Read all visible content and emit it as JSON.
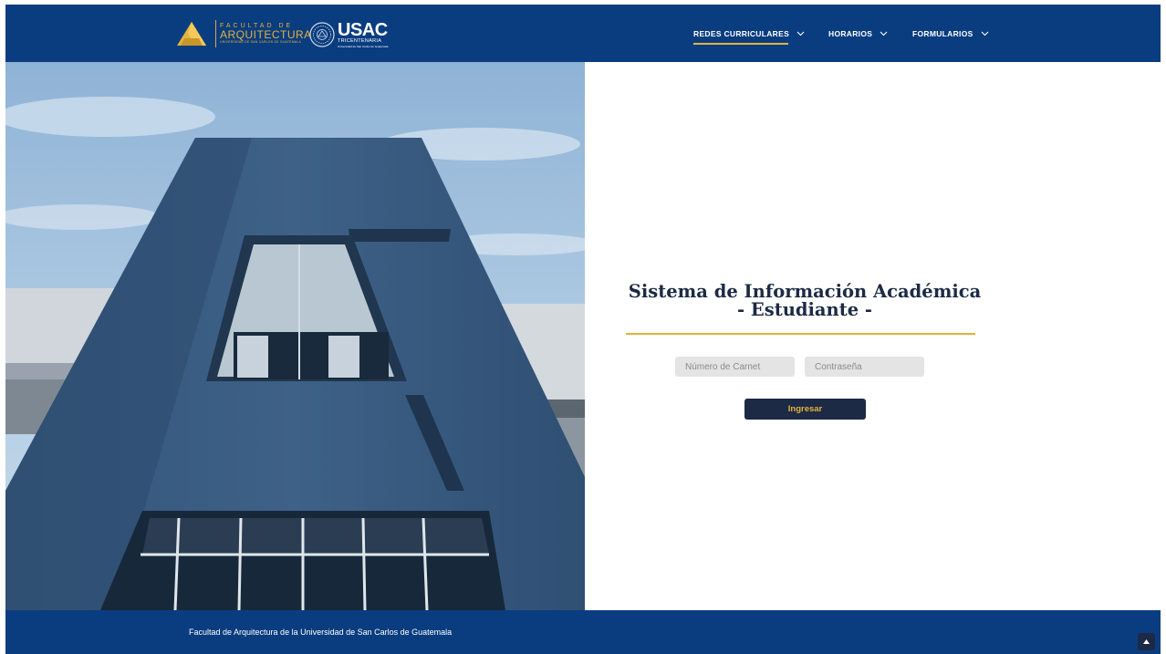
{
  "header": {
    "logo_faculty": {
      "line1": "FACULTAD DE",
      "line2": "ARQUITECTURA",
      "line3": "UNIVERSIDAD DE SAN CARLOS DE GUATEMALA"
    },
    "logo_usac": {
      "line1": "USAC",
      "line2": "TRICENTENARIA",
      "line3": "Universidad de San Carlos de Guatemala"
    },
    "nav": [
      {
        "label": "REDES CURRICULARES",
        "active": true
      },
      {
        "label": "HORARIOS",
        "active": false
      },
      {
        "label": "FORMULARIOS",
        "active": false
      }
    ]
  },
  "login": {
    "title_line1": "Sistema de Información Académica",
    "title_line2": "- Estudiante -",
    "carnet_placeholder": "Número de Carnet",
    "password_placeholder": "Contraseña",
    "submit_label": "Ingresar"
  },
  "footer": {
    "text": "Facultad de Arquitectura de la Universidad de San Carlos de Guatemala"
  },
  "colors": {
    "brand_blue": "#0a3d80",
    "navy": "#1c2a45",
    "accent_gold": "#e3b23c"
  }
}
